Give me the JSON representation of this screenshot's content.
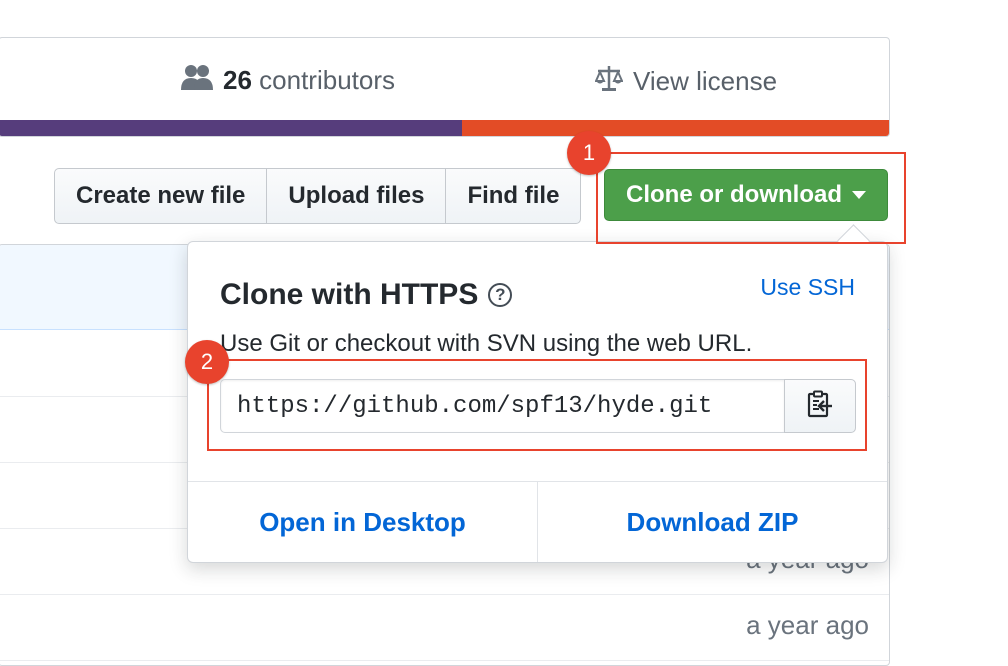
{
  "summary": {
    "contributors_count": "26",
    "contributors_label": "contributors",
    "license_label": "View license",
    "language_colors": [
      "#563d7c",
      "#e34c26"
    ],
    "language_shares": [
      0.52,
      0.48
    ]
  },
  "file_list": {
    "ages": [
      "a year ago",
      "a year ago"
    ]
  },
  "toolbar": {
    "create_label": "Create new file",
    "upload_label": "Upload files",
    "find_label": "Find file",
    "clone_label": "Clone or download"
  },
  "clone_panel": {
    "title": "Clone with HTTPS",
    "help_glyph": "?",
    "ssh_link": "Use SSH",
    "description": "Use Git or checkout with SVN using the web URL.",
    "url": "https://github.com/spf13/hyde.git",
    "desktop_label": "Open in Desktop",
    "zip_label": "Download ZIP"
  },
  "annotations": {
    "step1": "1",
    "step2": "2",
    "color": "#e8432d"
  },
  "icons": {
    "contributors": "people-icon",
    "license": "law-icon",
    "copy": "clippy-icon",
    "help": "question-icon",
    "caret": "triangle-down-icon"
  }
}
